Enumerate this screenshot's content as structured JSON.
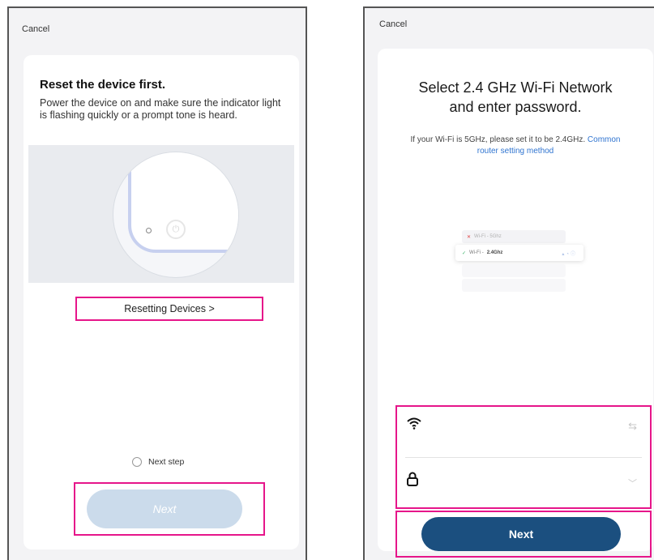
{
  "left_screen": {
    "cancel_label": "Cancel",
    "title": "Reset the device first.",
    "description": "Power the device on and make sure the indicator light is flashing quickly or a prompt tone is heard.",
    "reset_link_label": "Resetting Devices  >",
    "next_step_label": "Next step",
    "next_button_label": "Next",
    "next_button_enabled": false
  },
  "right_screen": {
    "cancel_label": "Cancel",
    "title_line1": "Select 2.4 GHz Wi-Fi Network",
    "title_line2": "and enter password.",
    "desc_prefix": "If your Wi-Fi is 5GHz, please set it to be 2.4GHz.",
    "desc_link": "Common router setting method",
    "illustration": {
      "row1": "Wi-Fi - 5Ghz",
      "row2_prefix": "Wi-Fi -",
      "row2_band": "2.4Ghz"
    },
    "wifi_field_value": "",
    "password_field_value": "",
    "next_button_label": "Next"
  },
  "colors": {
    "highlight": "#e6158a",
    "primary_button": "#1b4f7f",
    "disabled_button": "#cbdbeb",
    "link": "#2f74d0"
  },
  "icons": [
    "power-icon",
    "wifi-icon",
    "swap-icon",
    "lock-icon",
    "chevron-down-icon",
    "check-icon",
    "x-icon"
  ]
}
